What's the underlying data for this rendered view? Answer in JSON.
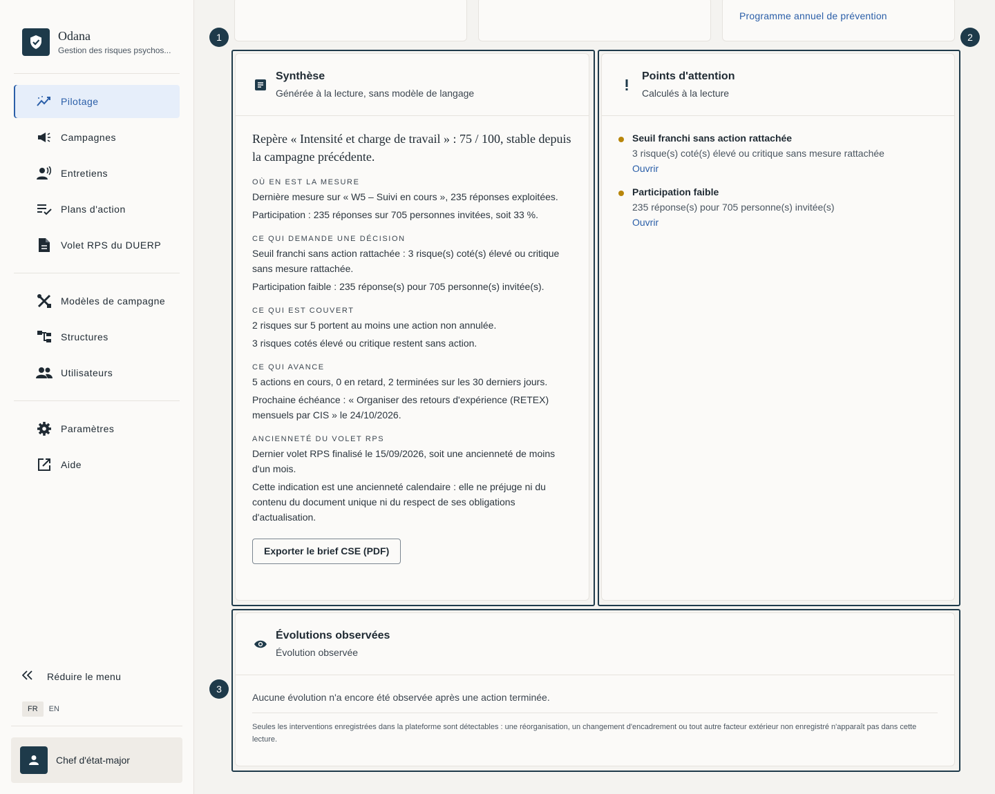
{
  "brand": {
    "name": "Odana",
    "subtitle": "Gestion des risques psychos..."
  },
  "nav": {
    "items": [
      {
        "label": "Pilotage",
        "icon": "trending-icon",
        "active": true
      },
      {
        "label": "Campagnes",
        "icon": "megaphone-icon"
      },
      {
        "label": "Entretiens",
        "icon": "speaking-person-icon"
      },
      {
        "label": "Plans d'action",
        "icon": "checklist-icon"
      },
      {
        "label": "Volet RPS du DUERP",
        "icon": "document-icon"
      }
    ],
    "admin_items": [
      {
        "label": "Modèles de campagne",
        "icon": "tools-icon"
      },
      {
        "label": "Structures",
        "icon": "hierarchy-icon"
      },
      {
        "label": "Utilisateurs",
        "icon": "group-icon"
      }
    ],
    "footer_items": [
      {
        "label": "Paramètres",
        "icon": "gear-icon"
      },
      {
        "label": "Aide",
        "icon": "external-link-icon"
      }
    ],
    "collapse_label": "Réduire le menu",
    "languages": [
      "FR",
      "EN"
    ],
    "active_language": "FR"
  },
  "user": {
    "name": "Chef d'état-major"
  },
  "top_cards": {
    "link_label": "Programme annuel de prévention"
  },
  "markers": [
    "1",
    "2",
    "3"
  ],
  "synthese": {
    "title": "Synthèse",
    "subtitle": "Générée à la lecture, sans modèle de langage",
    "lead": "Repère « Intensité et charge de travail » : 75 / 100, stable depuis la campagne précédente.",
    "sections": [
      {
        "label": "Où en est la mesure",
        "paragraphs": [
          "Dernière mesure sur « W5 – Suivi en cours », 235 réponses exploitées.",
          "Participation : 235 réponses sur 705 personnes invitées, soit 33 %."
        ]
      },
      {
        "label": "Ce qui demande une décision",
        "paragraphs": [
          "Seuil franchi sans action rattachée : 3 risque(s) coté(s) élevé ou critique sans mesure rattachée.",
          "Participation faible : 235 réponse(s) pour 705 personne(s) invitée(s)."
        ]
      },
      {
        "label": "Ce qui est couvert",
        "paragraphs": [
          "2 risques sur 5 portent au moins une action non annulée.",
          "3 risques cotés élevé ou critique restent sans action."
        ]
      },
      {
        "label": "Ce qui avance",
        "paragraphs": [
          "5 actions en cours, 0 en retard, 2 terminées sur les 30 derniers jours.",
          "Prochaine échéance : « Organiser des retours d'expérience (RETEX) mensuels par CIS » le 24/10/2026."
        ]
      },
      {
        "label": "Ancienneté du volet RPS",
        "paragraphs": [
          "Dernier volet RPS finalisé le 15/09/2026, soit une ancienneté de moins d'un mois.",
          "Cette indication est une ancienneté calendaire : elle ne préjuge ni du contenu du document unique ni du respect de ses obligations d'actualisation."
        ]
      }
    ],
    "export_label": "Exporter le brief CSE (PDF)"
  },
  "attention": {
    "title": "Points d'attention",
    "subtitle": "Calculés à la lecture",
    "items": [
      {
        "title": "Seuil franchi sans action rattachée",
        "desc": "3 risque(s) coté(s) élevé ou critique sans mesure rattachée",
        "link": "Ouvrir"
      },
      {
        "title": "Participation faible",
        "desc": "235 réponse(s) pour 705 personne(s) invitée(s)",
        "link": "Ouvrir"
      }
    ]
  },
  "evolutions": {
    "title": "Évolutions observées",
    "subtitle": "Évolution observée",
    "empty_text": "Aucune évolution n'a encore été observée après une action terminée.",
    "note": "Seules les interventions enregistrées dans la plateforme sont détectables : une réorganisation, un changement d'encadrement ou tout autre facteur extérieur non enregistré n'apparaît pas dans cette lecture."
  },
  "colors": {
    "primary": "#1e3a4a",
    "link": "#2a5ea8",
    "warning_dot": "#b8860b",
    "active_bg": "#e6eefa"
  }
}
